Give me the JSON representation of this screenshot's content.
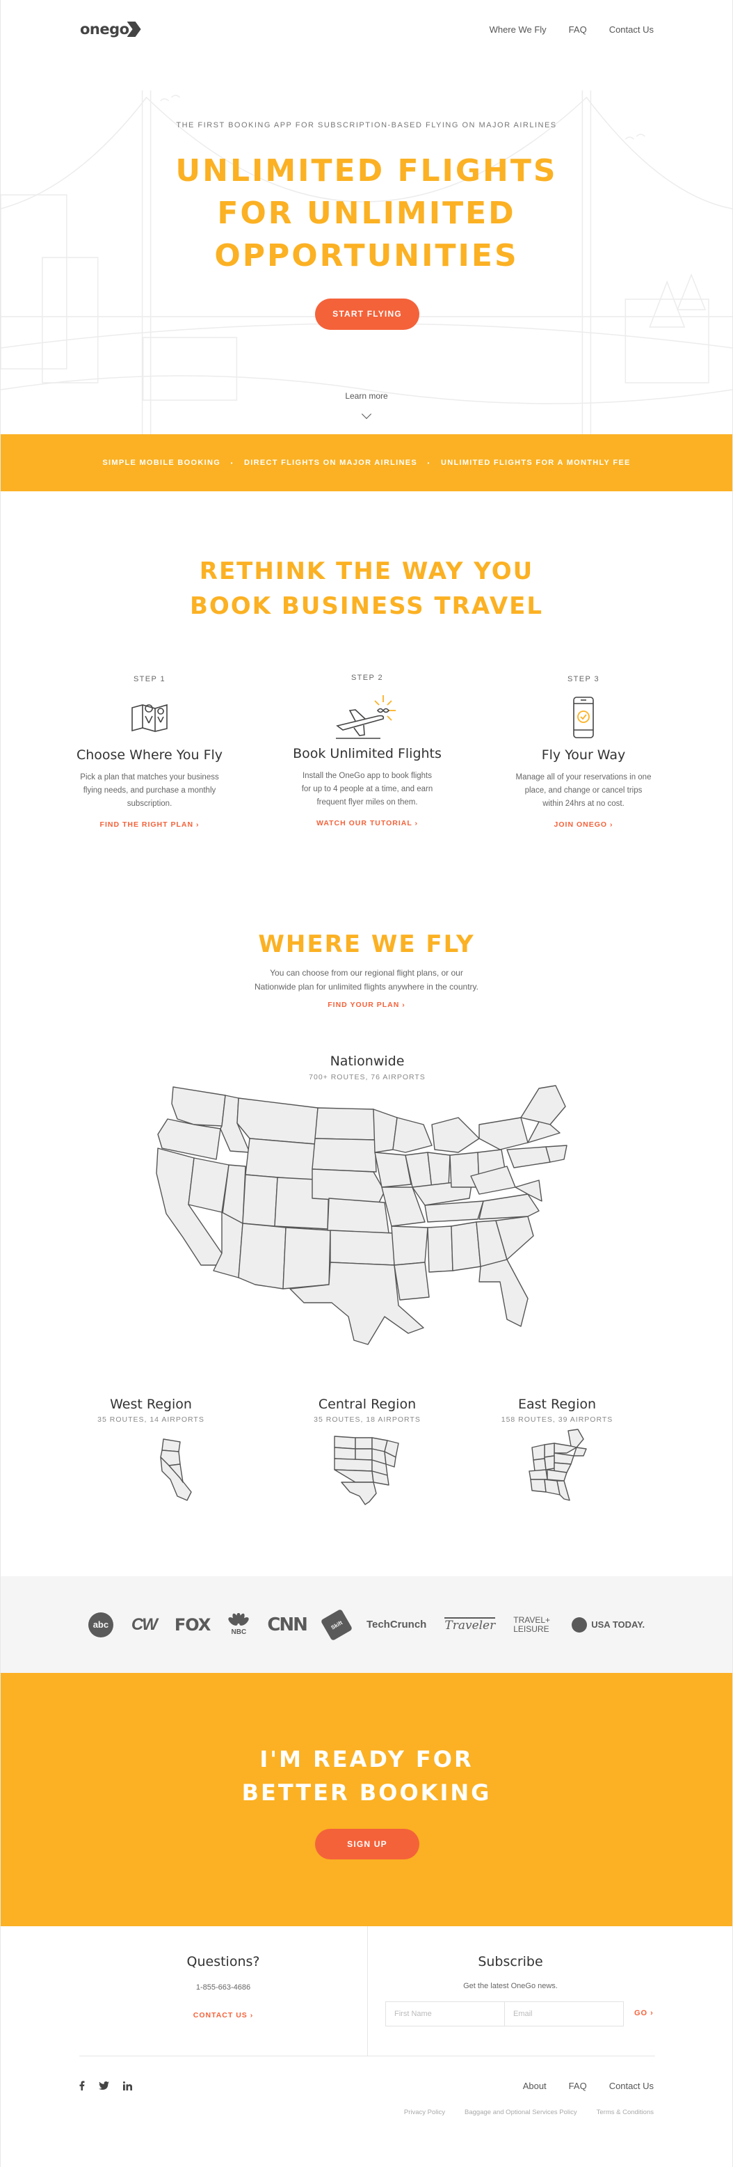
{
  "brand": {
    "logo_text": "onego",
    "accent": "#fbb123",
    "cta_color": "#f4623a"
  },
  "nav": {
    "items": [
      "Where We Fly",
      "FAQ",
      "Contact Us"
    ]
  },
  "hero": {
    "eyebrow": "THE FIRST BOOKING APP FOR SUBSCRIPTION-BASED FLYING ON MAJOR AIRLINES",
    "title_lines": [
      "UNLIMITED FLIGHTS",
      "FOR UNLIMITED",
      "OPPORTUNITIES"
    ],
    "cta": "START FLYING",
    "learn_more": "Learn more"
  },
  "features": [
    "SIMPLE MOBILE BOOKING",
    "DIRECT FLIGHTS ON MAJOR AIRLINES",
    "UNLIMITED FLIGHTS FOR A MONTHLY FEE"
  ],
  "rethink": {
    "title_lines": [
      "RETHINK THE WAY YOU",
      "BOOK BUSINESS TRAVEL"
    ],
    "steps": [
      {
        "label": "STEP 1",
        "icon": "map-icon",
        "title": "Choose Where You Fly",
        "desc": "Pick a plan that matches your business flying needs, and purchase a monthly subscription.",
        "link": "FIND THE RIGHT PLAN"
      },
      {
        "label": "STEP 2",
        "icon": "plane-icon",
        "title": "Book Unlimited Flights",
        "desc": "Install the OneGo app to book flights for up to 4 people at a time, and earn frequent flyer miles on them.",
        "link": "WATCH OUR TUTORIAL"
      },
      {
        "label": "STEP 3",
        "icon": "phone-check-icon",
        "title": "Fly Your Way",
        "desc": "Manage all of your reservations in one place, and change or cancel trips within 24hrs at no cost.",
        "link": "JOIN ONEGO"
      }
    ]
  },
  "where": {
    "title": "WHERE WE FLY",
    "desc_lines": [
      "You can choose from our regional flight plans, or our",
      "Nationwide plan for unlimited flights anywhere in the country."
    ],
    "link": "FIND YOUR PLAN",
    "nationwide": {
      "title": "Nationwide",
      "sub": "700+ ROUTES, 76 AIRPORTS"
    },
    "regions": [
      {
        "title": "West Region",
        "sub": "35 ROUTES, 14 AIRPORTS"
      },
      {
        "title": "Central Region",
        "sub": "35 ROUTES, 18 AIRPORTS"
      },
      {
        "title": "East Region",
        "sub": "158 ROUTES, 39 AIRPORTS"
      }
    ]
  },
  "press": [
    "abc",
    "CW",
    "FOX",
    "NBC",
    "CNN",
    "Skift",
    "TechCrunch",
    "Traveler",
    "TRAVEL+ LEISURE",
    "USA TODAY."
  ],
  "cta": {
    "title_lines": [
      "I'M READY FOR",
      "BETTER BOOKING"
    ],
    "button": "SIGN UP"
  },
  "footer": {
    "questions_title": "Questions?",
    "phone": "1-855-663-4686",
    "contact_link": "CONTACT US",
    "subscribe_title": "Subscribe",
    "subscribe_text": "Get the latest OneGo news.",
    "first_name_placeholder": "First Name",
    "email_placeholder": "Email",
    "go": "GO",
    "nav": [
      "About",
      "FAQ",
      "Contact Us"
    ],
    "legal": [
      "Privacy Policy",
      "Baggage and Optional Services Policy",
      "Terms & Conditions"
    ],
    "social": [
      "facebook-icon",
      "twitter-icon",
      "linkedin-icon"
    ]
  }
}
